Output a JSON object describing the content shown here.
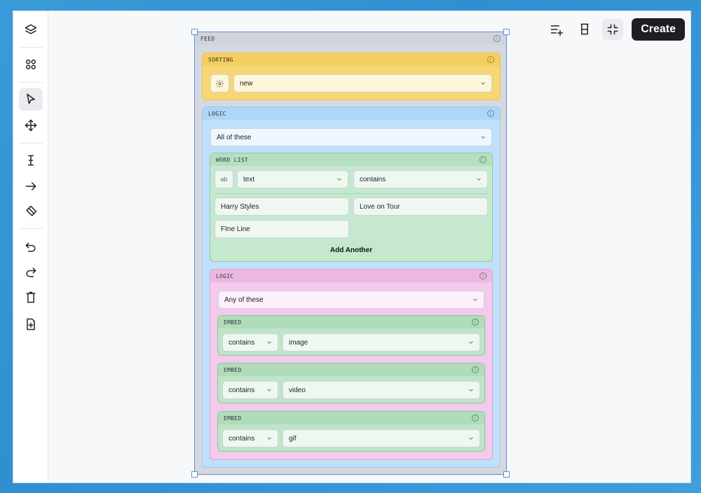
{
  "toolbar": {
    "tools": [
      {
        "name": "layers-icon"
      },
      {
        "name": "components-icon"
      },
      {
        "name": "select-pointer-icon",
        "active": true
      },
      {
        "name": "move-icon"
      },
      {
        "name": "text-cursor-icon"
      },
      {
        "name": "arrow-right-icon"
      },
      {
        "name": "eraser-icon"
      },
      {
        "name": "undo-icon"
      },
      {
        "name": "redo-icon"
      },
      {
        "name": "trash-icon"
      },
      {
        "name": "add-page-icon"
      }
    ]
  },
  "header": {
    "create_label": "Create"
  },
  "feed": {
    "label": "FEED",
    "sorting": {
      "label": "SORTING",
      "value": "new"
    },
    "logic": {
      "label": "LOGIC",
      "mode": "All of these",
      "word_list": {
        "label": "WORD LIST",
        "type_badge": "ab",
        "field": "text",
        "operator": "contains",
        "words": [
          "Harry Styles",
          "Love on Tour",
          "FIne Line"
        ],
        "add_label": "Add Another"
      },
      "nested_logic": {
        "label": "LOGIC",
        "mode": "Any of these",
        "embeds": [
          {
            "label": "EMBED",
            "operator": "contains",
            "value": "image"
          },
          {
            "label": "EMBED",
            "operator": "contains",
            "value": "video"
          },
          {
            "label": "EMBED",
            "operator": "contains",
            "value": "gif"
          }
        ]
      }
    }
  },
  "colors": {
    "sorting": "#f7d774",
    "logic": "#bfe0fa",
    "word_list": "#c5e8cf",
    "nested_logic": "#f3c9ec",
    "embed": "#bfe5c9",
    "accent": "#5b8fdd"
  }
}
